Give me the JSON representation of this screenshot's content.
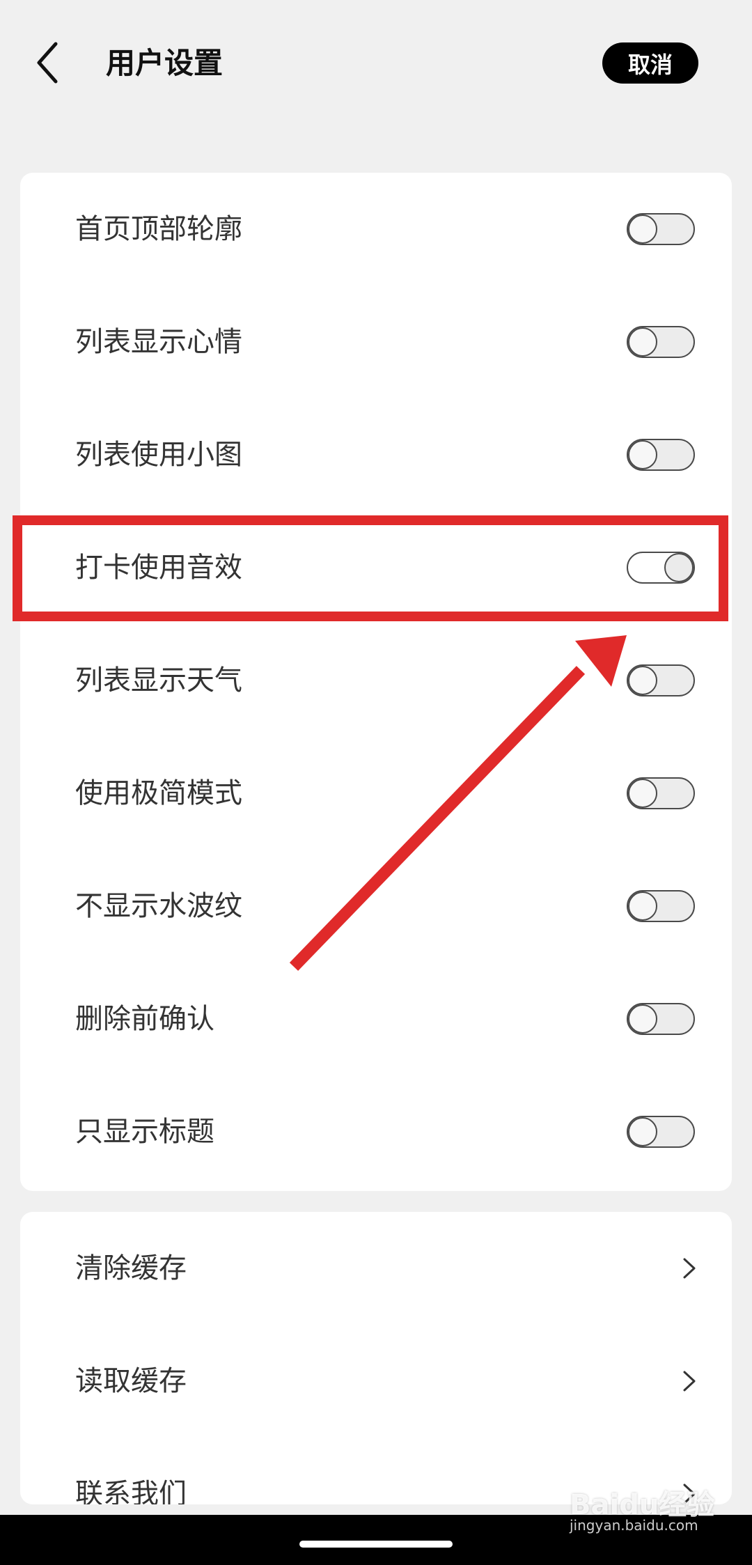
{
  "header": {
    "title": "用户设置",
    "cancel_label": "取消"
  },
  "toggle_rows": [
    {
      "label": "首页顶部轮廓",
      "on": false
    },
    {
      "label": "列表显示心情",
      "on": false
    },
    {
      "label": "列表使用小图",
      "on": false
    },
    {
      "label": "打卡使用音效",
      "on": true
    },
    {
      "label": "列表显示天气",
      "on": false
    },
    {
      "label": "使用极简模式",
      "on": false
    },
    {
      "label": "不显示水波纹",
      "on": false
    },
    {
      "label": "删除前确认",
      "on": false
    },
    {
      "label": "只显示标题",
      "on": false
    }
  ],
  "action_rows": [
    {
      "label": "清除缓存"
    },
    {
      "label": "读取缓存"
    },
    {
      "label": "联系我们"
    }
  ],
  "annotation": {
    "color": "#e02a2a"
  },
  "watermark": {
    "text": "Baidu经验",
    "url": "jingyan.baidu.com"
  }
}
